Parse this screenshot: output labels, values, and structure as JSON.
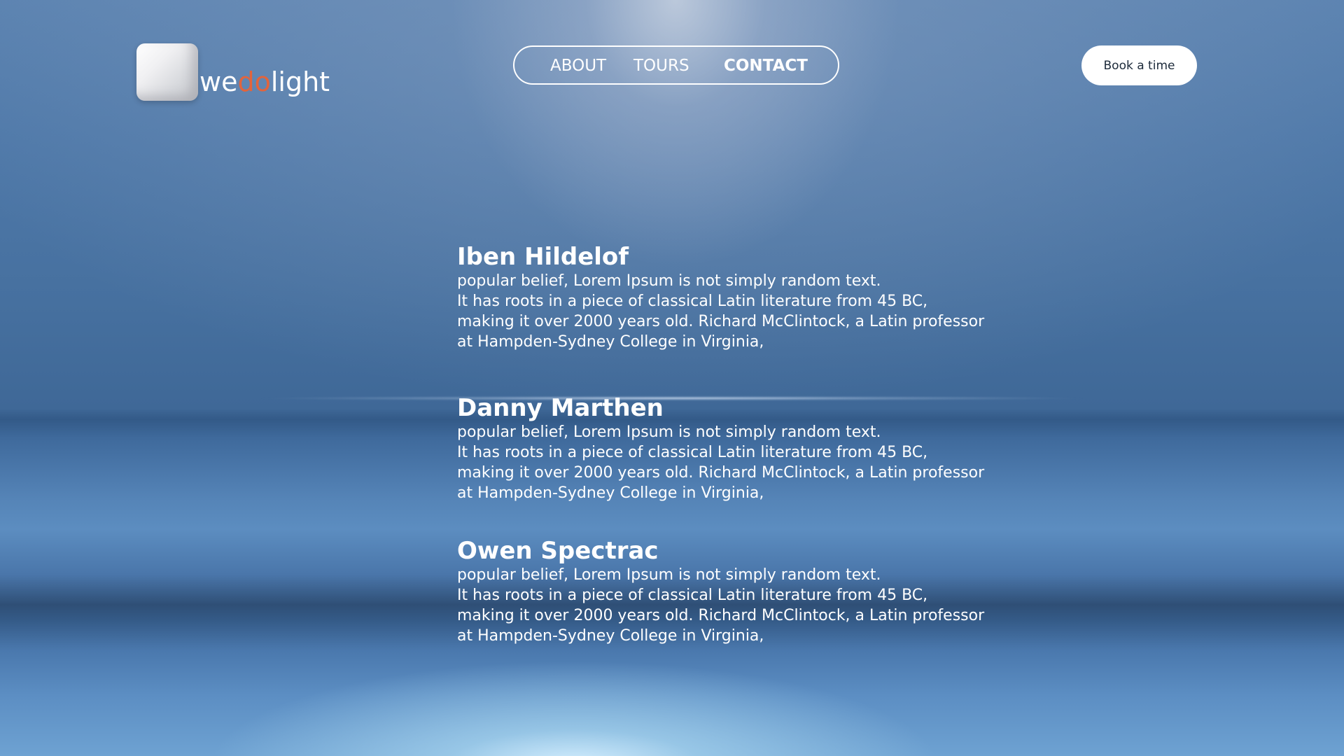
{
  "logo": {
    "text_we": "we",
    "text_do": "do",
    "text_light": "light",
    "accent_color": "#e2643c"
  },
  "nav": {
    "items": [
      {
        "label": "ABOUT"
      },
      {
        "label": "TOURS"
      },
      {
        "label": "CONTACT",
        "active": true
      }
    ]
  },
  "cta": {
    "label": "Book a time"
  },
  "contacts": [
    {
      "name": "Iben Hildelof",
      "lines": [
        "popular belief, Lorem Ipsum is not simply random text.",
        "It has roots in a piece of classical Latin literature from 45 BC,",
        "making it over 2000 years old. Richard McClintock, a Latin professor",
        "at Hampden-Sydney College in Virginia,"
      ]
    },
    {
      "name": "Danny Marthen",
      "lines": [
        "popular belief, Lorem Ipsum is not simply random text.",
        "It has roots in a piece of classical Latin literature from 45 BC,",
        "making it over 2000 years old. Richard McClintock, a Latin professor",
        "at Hampden-Sydney College in Virginia,"
      ]
    },
    {
      "name": "Owen Spectrac",
      "lines": [
        "popular belief, Lorem Ipsum is not simply random text.",
        "It has roots in a piece of classical Latin literature from 45 BC,",
        "making it over 2000 years old. Richard McClintock, a Latin professor",
        "at Hampden-Sydney College in Virginia,"
      ]
    }
  ]
}
